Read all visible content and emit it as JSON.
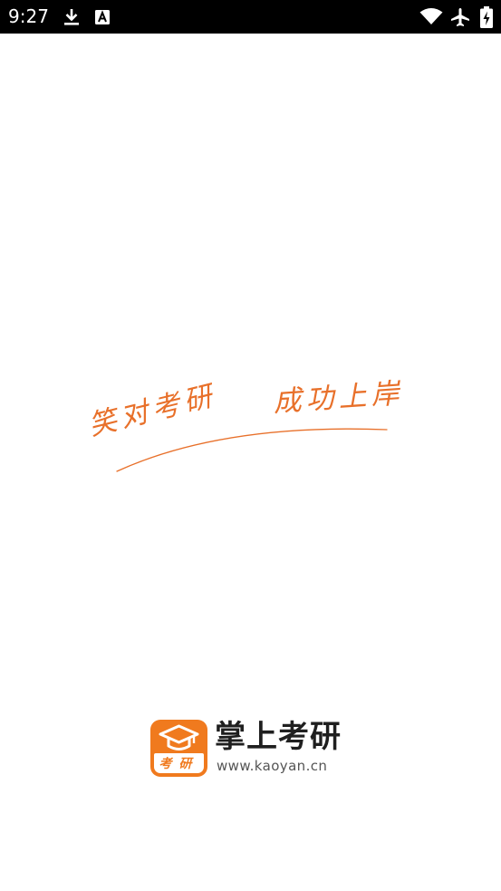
{
  "status_bar": {
    "time": "9:27",
    "icons": [
      "download-icon",
      "keyboard-a-icon",
      "wifi-icon",
      "airplane-mode-icon",
      "battery-charging-icon"
    ]
  },
  "splash": {
    "slogan_left": "笑对考研",
    "slogan_right": "成功上岸",
    "accent_color": "#e8702a"
  },
  "brand": {
    "logo_text": "考研",
    "app_name": "掌上考研",
    "website": "www.kaoyan.cn",
    "logo_color": "#f07a1e"
  }
}
